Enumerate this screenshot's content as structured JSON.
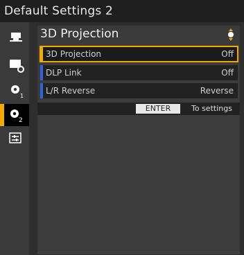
{
  "header": {
    "title": "Default Settings 2"
  },
  "sidebar": {
    "items": [
      {
        "icon": "projector-icon"
      },
      {
        "icon": "display-settings-icon"
      },
      {
        "icon": "gear-1-icon"
      },
      {
        "icon": "gear-2-icon",
        "active": true
      },
      {
        "icon": "sliders-icon"
      }
    ]
  },
  "panel": {
    "title": "3D Projection",
    "rows": [
      {
        "label": "3D Projection",
        "value": "Off"
      },
      {
        "label": "DLP Link",
        "value": "Off"
      },
      {
        "label": "L/R Reverse",
        "value": "Reverse"
      }
    ],
    "footer": {
      "button": "ENTER",
      "hint": "To settings"
    }
  },
  "colors": {
    "accent": "#f2a900",
    "row_bar": "#2f64d8"
  }
}
